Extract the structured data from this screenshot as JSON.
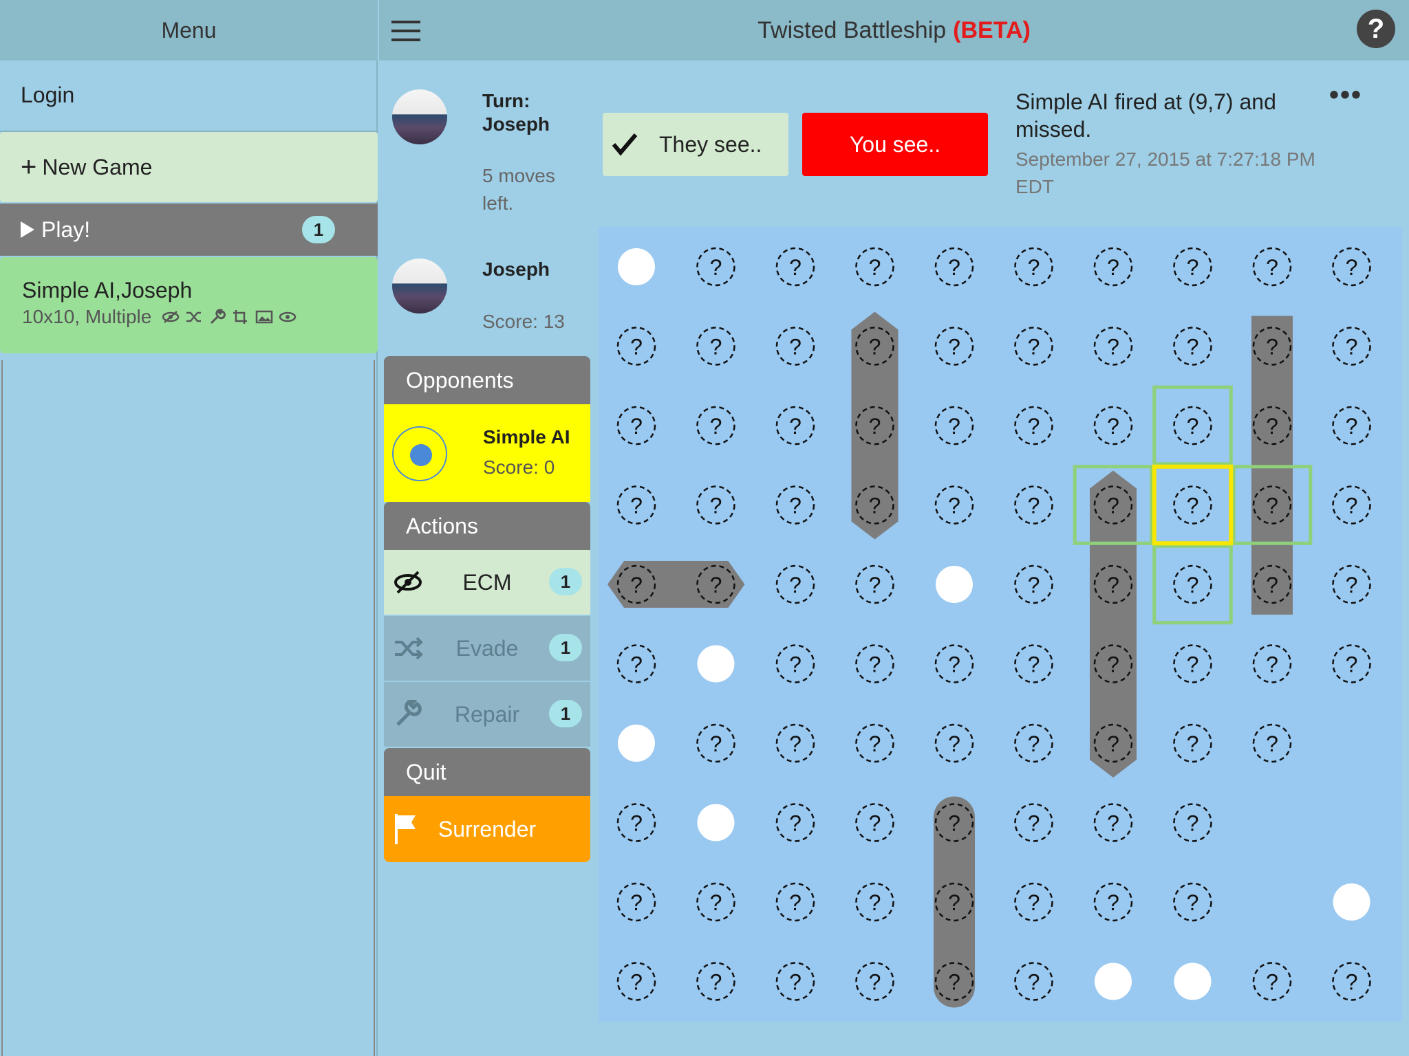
{
  "menu": {
    "title": "Menu",
    "login": "Login",
    "new_game": "New Game",
    "play": {
      "label": "Play!",
      "count": "1"
    },
    "game": {
      "players": "Simple AI,Joseph",
      "details": "10x10, Multiple"
    }
  },
  "app": {
    "title": "Twisted Battleship",
    "beta": "(BETA)",
    "help": "?"
  },
  "turn": {
    "label": "Turn:",
    "player": "Joseph",
    "moves": "5 moves left."
  },
  "player": {
    "name": "Joseph",
    "score": "Score: 13"
  },
  "opponents": {
    "header": "Opponents",
    "list": [
      {
        "name": "Simple AI",
        "score": "Score: 0"
      }
    ]
  },
  "actions": {
    "header": "Actions",
    "items": [
      {
        "label": "ECM",
        "count": "1",
        "icon": "eye-slash-icon"
      },
      {
        "label": "Evade",
        "count": "1",
        "icon": "shuffle-icon"
      },
      {
        "label": "Repair",
        "count": "1",
        "icon": "wrench-icon"
      }
    ]
  },
  "quit": {
    "header": "Quit",
    "surrender": "Surrender"
  },
  "view": {
    "they_see": "They see..",
    "you_see": "You see.."
  },
  "event": {
    "message": "Simple AI fired at (9,7) and missed.",
    "timestamp": "September 27, 2015 at 7:27:18 PM EDT"
  },
  "more": "•••",
  "colors": {
    "accent": "#ff0000",
    "selection": "#ffff00",
    "play_area": "#99c8f0",
    "surrender": "#ffa000"
  },
  "board": {
    "size": "10x10",
    "cell_symbol": "?",
    "grid": [
      "M?????????",
      "??????????",
      "??????????",
      "??????????",
      "????M?????",
      "?M????????",
      "M????????.",
      "?M??????..",
      "????????.M",
      "??????MM??"
    ],
    "legend": {
      "?": "unknown",
      "M": "miss",
      ".": "empty"
    },
    "selected_cell": "(7,3)"
  }
}
